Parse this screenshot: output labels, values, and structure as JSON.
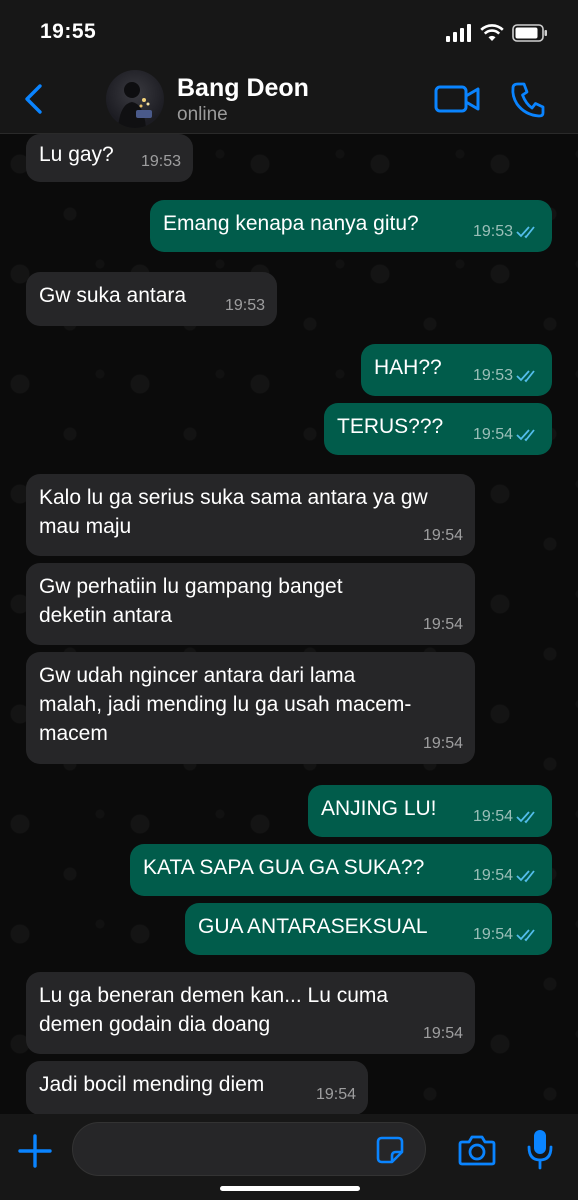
{
  "status_bar": {
    "time": "19:55"
  },
  "header": {
    "contact_name": "Bang Deon",
    "contact_status": "online"
  },
  "colors": {
    "accent": "#0a84ff",
    "outgoing_bubble": "#015c4b",
    "incoming_bubble": "#262628",
    "read_ticks": "#53bdeb"
  },
  "messages": [
    {
      "direction": "incoming",
      "text": "Lu gay?",
      "time": "19:53"
    },
    {
      "direction": "outgoing",
      "text": "Emang kenapa nanya gitu?",
      "time": "19:53",
      "status": "read"
    },
    {
      "direction": "incoming",
      "text": "Gw suka antara",
      "time": "19:53"
    },
    {
      "direction": "outgoing",
      "text": "HAH??",
      "time": "19:53",
      "status": "read"
    },
    {
      "direction": "outgoing",
      "text": "TERUS???",
      "time": "19:54",
      "status": "read"
    },
    {
      "direction": "incoming",
      "text": "Kalo lu ga serius suka sama antara ya gw mau maju",
      "time": "19:54"
    },
    {
      "direction": "incoming",
      "text": "Gw perhatiin lu gampang banget deketin antara",
      "time": "19:54"
    },
    {
      "direction": "incoming",
      "text": "Gw udah ngincer antara dari lama malah, jadi mending lu ga usah macem-macem",
      "time": "19:54"
    },
    {
      "direction": "outgoing",
      "text": "ANJING LU!",
      "time": "19:54",
      "status": "read"
    },
    {
      "direction": "outgoing",
      "text": "KATA SAPA GUA GA SUKA??",
      "time": "19:54",
      "status": "read"
    },
    {
      "direction": "outgoing",
      "text": "GUA ANTARASEKSUAL",
      "time": "19:54",
      "status": "read"
    },
    {
      "direction": "incoming",
      "text": "Lu ga beneran demen kan... Lu cuma demen godain dia doang",
      "time": "19:54"
    },
    {
      "direction": "incoming",
      "text": "Jadi bocil mending diem",
      "time": "19:54"
    }
  ],
  "icons": {
    "back": "chevron-left-icon",
    "video": "video-camera-icon",
    "call": "phone-icon",
    "plus": "plus-icon",
    "sticker": "sticker-icon",
    "camera": "camera-icon",
    "mic": "microphone-icon"
  }
}
